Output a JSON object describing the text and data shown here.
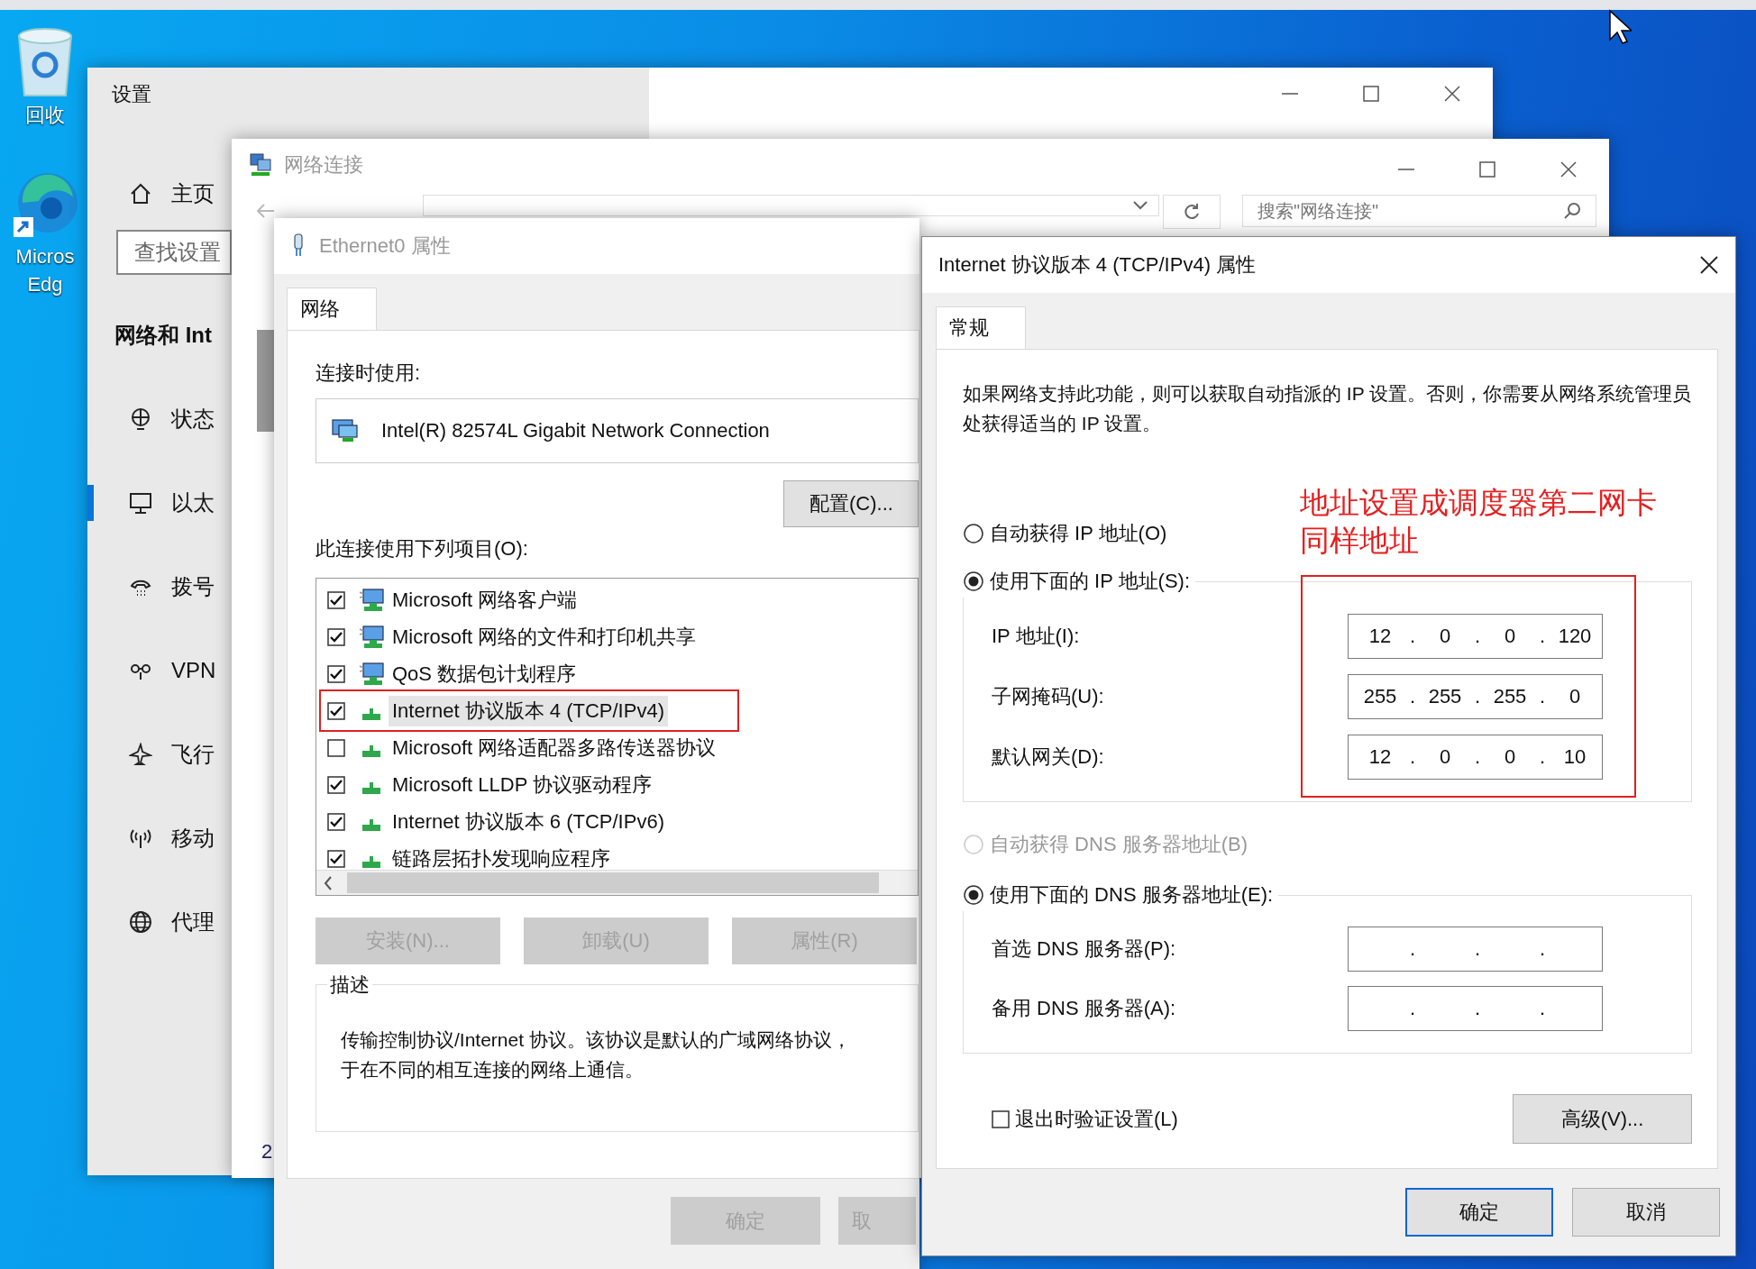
{
  "desktop": {
    "icons": [
      {
        "kind": "recycle_bin",
        "lines": [
          "回收"
        ]
      },
      {
        "kind": "browser",
        "lines": [
          "Micros",
          "Edg"
        ]
      }
    ]
  },
  "settings_window": {
    "title": "设置",
    "home": "主页",
    "search": {
      "placeholder": "查找设置"
    },
    "section_heading": "网络和 Int",
    "nav_items": [
      {
        "kind": "status",
        "label": "状态",
        "selected": false
      },
      {
        "kind": "ethernet",
        "label": "以太",
        "selected": true
      },
      {
        "kind": "dialup",
        "label": "拨号",
        "selected": false
      },
      {
        "kind": "vpn",
        "label": "VPN",
        "selected": false
      },
      {
        "kind": "airplane",
        "label": "飞行",
        "selected": false
      },
      {
        "kind": "hotspot",
        "label": "移动",
        "selected": false
      },
      {
        "kind": "proxy",
        "label": "代理",
        "selected": false
      }
    ]
  },
  "network_connections_window": {
    "title": "网络连接",
    "search": {
      "placeholder": "搜索\"网络连接\""
    },
    "status_bar": "2"
  },
  "ethernet_dialog": {
    "title": "Ethernet0 属性",
    "tabs": [
      {
        "label": "网络",
        "selected": true
      }
    ],
    "connect_using_label": "连接时使用:",
    "adapter": "Intel(R) 82574L Gigabit Network Connection",
    "configure_button": "配置(C)...",
    "items_label": "此连接使用下列项目(O):",
    "items": [
      {
        "kind": "service",
        "label": "Microsoft 网络客户端",
        "checked": true,
        "selected": false,
        "annotated": false
      },
      {
        "kind": "service",
        "label": "Microsoft 网络的文件和打印机共享",
        "checked": true,
        "selected": false,
        "annotated": false
      },
      {
        "kind": "service",
        "label": "QoS 数据包计划程序",
        "checked": true,
        "selected": false,
        "annotated": false
      },
      {
        "kind": "protocol",
        "label": "Internet 协议版本 4 (TCP/IPv4)",
        "checked": true,
        "selected": true,
        "annotated": true
      },
      {
        "kind": "protocol",
        "label": "Microsoft 网络适配器多路传送器协议",
        "checked": false,
        "selected": false,
        "annotated": false
      },
      {
        "kind": "protocol",
        "label": "Microsoft LLDP 协议驱动程序",
        "checked": true,
        "selected": false,
        "annotated": false
      },
      {
        "kind": "protocol",
        "label": "Internet 协议版本 6 (TCP/IPv6)",
        "checked": true,
        "selected": false,
        "annotated": false
      },
      {
        "kind": "protocol",
        "label": "链路层拓扑发现响应程序",
        "checked": true,
        "selected": false,
        "annotated": false
      }
    ],
    "buttons": [
      {
        "label": "安装(N)...",
        "disabled": true
      },
      {
        "label": "卸载(U)",
        "disabled": true
      },
      {
        "label": "属性(R)",
        "disabled": true
      }
    ],
    "description": {
      "title": "描述",
      "lines": [
        "传输控制协议/Internet 协议。该协议是默认的广域网络协议，",
        "于在不同的相互连接的网络上通信。"
      ]
    },
    "footer_buttons": [
      {
        "label": "确定",
        "disabled": true
      },
      {
        "label": "取",
        "disabled": true
      }
    ]
  },
  "ipv4_dialog": {
    "title": "Internet 协议版本 4 (TCP/IPv4) 属性",
    "tabs": [
      {
        "label": "常规",
        "selected": true
      }
    ],
    "intro": "如果网络支持此功能，则可以获取自动指派的 IP 设置。否则，你需要从网络系统管理员处获得适当的 IP 设置。",
    "annotation": [
      "地址设置成调度器第二网卡",
      "同样地址"
    ],
    "ip_mode": [
      {
        "label": "自动获得 IP 地址(O)",
        "selected": false,
        "disabled": false
      },
      {
        "label": "使用下面的 IP 地址(S):",
        "selected": true,
        "disabled": false
      }
    ],
    "ip_fields_annotated": true,
    "ip_fields": [
      {
        "label": "IP 地址(I):",
        "octets": [
          "12",
          "0",
          "0",
          "120"
        ],
        "separators": [
          ".",
          ".",
          "."
        ]
      },
      {
        "label": "子网掩码(U):",
        "octets": [
          "255",
          "255",
          "255",
          "0"
        ],
        "separators": [
          ".",
          ".",
          "."
        ]
      },
      {
        "label": "默认网关(D):",
        "octets": [
          "12",
          "0",
          "0",
          "10"
        ],
        "separators": [
          ".",
          ".",
          "."
        ]
      }
    ],
    "dns_mode": [
      {
        "label": "自动获得 DNS 服务器地址(B)",
        "selected": false,
        "disabled": true
      },
      {
        "label": "使用下面的 DNS 服务器地址(E):",
        "selected": true,
        "disabled": false
      }
    ],
    "dns_fields": [
      {
        "label": "首选 DNS 服务器(P):",
        "separators": [
          ".",
          ".",
          "."
        ]
      },
      {
        "label": "备用 DNS 服务器(A):",
        "separators": [
          ".",
          ".",
          "."
        ]
      }
    ],
    "verify_on_exit": {
      "label": "退出时验证设置(L)",
      "checked": false
    },
    "advanced_button": "高级(V)...",
    "footer_buttons": [
      {
        "label": "确定",
        "default": true
      },
      {
        "label": "取消",
        "default": false
      }
    ]
  }
}
